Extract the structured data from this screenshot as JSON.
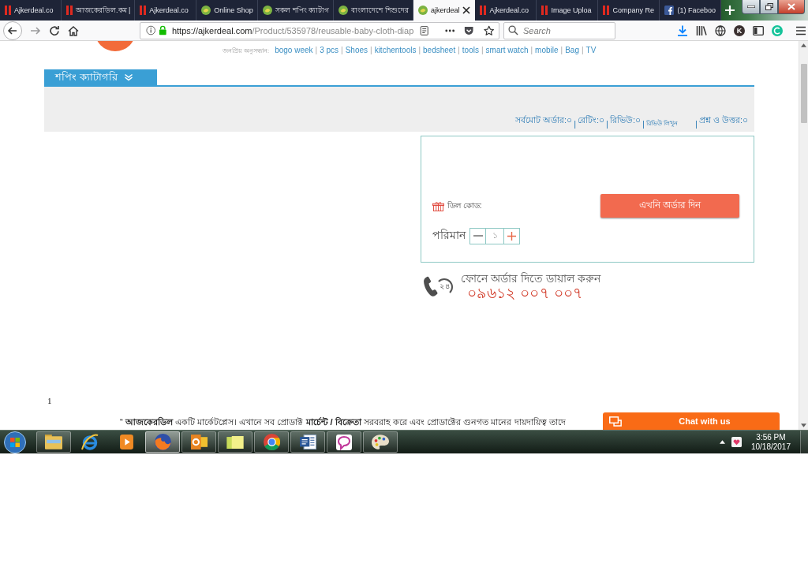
{
  "browser": {
    "tabs": [
      {
        "title": "Ajkerdeal.co",
        "kind": "bars",
        "selected": false
      },
      {
        "title": "আজকেরডিল.কম |",
        "kind": "bars",
        "selected": false
      },
      {
        "title": "Ajkerdeal.co",
        "kind": "bars",
        "selected": false
      },
      {
        "title": "Online Shop",
        "kind": "leaf",
        "selected": false
      },
      {
        "title": "সকল শপিং ক্যাটাগ",
        "kind": "leaf",
        "selected": false
      },
      {
        "title": "বাংলাদেশে শিশুদের",
        "kind": "leaf",
        "selected": false
      },
      {
        "title": "ajkerdeal",
        "kind": "leaf",
        "selected": true
      },
      {
        "title": "Ajkerdeal.co",
        "kind": "bars",
        "selected": false
      },
      {
        "title": "Image Uploa",
        "kind": "bars",
        "selected": false
      },
      {
        "title": "Company Re",
        "kind": "bars",
        "selected": false
      },
      {
        "title": "(1) Faceboo",
        "kind": "f-logo",
        "selected": false
      }
    ],
    "address_bar": {
      "host": "https://ajkerdeal.com",
      "path": "/Product/535978/reusable-baby-cloth-diap"
    },
    "search_field": {
      "placeholder": "Search"
    },
    "extension_badge": "K"
  },
  "page": {
    "popular_search": {
      "label": "জনপ্রিয় অনুসন্ধান:",
      "items": [
        {
          "kind": "link",
          "text": "bogo week"
        },
        {
          "kind": "separator",
          "text": "|"
        },
        {
          "kind": "link",
          "text": "3 pcs"
        },
        {
          "kind": "separator",
          "text": "|"
        },
        {
          "kind": "link",
          "text": "Shoes"
        },
        {
          "kind": "separator",
          "text": "|"
        },
        {
          "kind": "link",
          "text": "kitchentools"
        },
        {
          "kind": "separator",
          "text": "|"
        },
        {
          "kind": "link",
          "text": "bedsheet"
        },
        {
          "kind": "separator",
          "text": "|"
        },
        {
          "kind": "link",
          "text": "tools"
        },
        {
          "kind": "separator",
          "text": "|"
        },
        {
          "kind": "link",
          "text": "smart watch"
        },
        {
          "kind": "separator",
          "text": "|"
        },
        {
          "kind": "link",
          "text": "mobile"
        },
        {
          "kind": "separator",
          "text": "|"
        },
        {
          "kind": "link",
          "text": "Bag"
        },
        {
          "kind": "separator",
          "text": "|"
        },
        {
          "kind": "link",
          "text": "TV"
        }
      ]
    },
    "category_menu": {
      "label": "শপিং ক্যাটাগরি"
    },
    "product_stats": [
      {
        "kind": "link",
        "text": "সর্বমোট অর্ডার:০"
      },
      {
        "kind": "separator",
        "text": "|"
      },
      {
        "kind": "link",
        "text": "রেটিং:০"
      },
      {
        "kind": "separator",
        "text": "|"
      },
      {
        "kind": "link",
        "text": "রিভিউ:০"
      },
      {
        "kind": "separator",
        "text": "|"
      },
      {
        "kind": "small-link",
        "text": "রিভিউ লিখুন"
      },
      {
        "kind": "separator",
        "text": "|"
      },
      {
        "kind": "link",
        "text": "প্রশ্ন ও উত্তর:০"
      }
    ],
    "order_box": {
      "deal_code_label": "ডিল কোড:",
      "order_button": "এখনি অর্ডার দিন",
      "quantity_label": "পরিমান",
      "quantity": "১"
    },
    "hotline": {
      "badge": "২৪",
      "caption": "ফোনে অর্ডার দিতে ডায়াল করুন",
      "number": "০৯৬১২ ০০৭ ০০৭"
    },
    "page_number": "1",
    "notice": "“ **আজকেরডিল** একটি মার্কেটপ্লেস। এখানে সব প্রোডাক্ট **মার্চেন্ট / বিক্রেতা** সরবরাহ করে এবং প্রোডাক্টের গুনগত মানের দায়দায়িত্ব তাদে"
  },
  "chat_widget": {
    "label": "Chat with us"
  },
  "taskbar": {
    "apps": [
      {
        "kind": "explorer",
        "running": true,
        "selected": false
      },
      {
        "kind": "ie",
        "running": false,
        "selected": false
      },
      {
        "kind": "media",
        "running": false,
        "selected": false
      },
      {
        "kind": "firefox",
        "running": true,
        "selected": true
      },
      {
        "kind": "outlook",
        "running": true,
        "selected": false
      },
      {
        "kind": "notes",
        "running": true,
        "selected": false
      },
      {
        "kind": "chrome",
        "running": true,
        "selected": false
      },
      {
        "kind": "word",
        "running": true,
        "selected": false
      },
      {
        "kind": "messenger",
        "running": true,
        "selected": false
      },
      {
        "kind": "paint",
        "running": true,
        "selected": false
      }
    ],
    "clock": {
      "time": "3:56 PM",
      "date": "10/18/2017"
    }
  }
}
